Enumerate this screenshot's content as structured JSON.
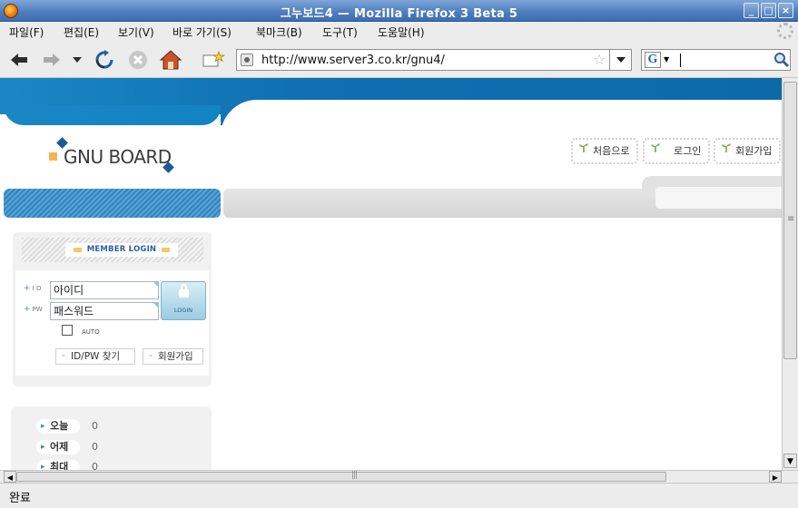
{
  "window": {
    "title": "그누보드4 — Mozilla Firefox 3 Beta 5",
    "min_label": "_",
    "max_label": "□",
    "close_label": "×"
  },
  "menu": [
    {
      "label": "파일(F)"
    },
    {
      "label": "편집(E)"
    },
    {
      "label": "보기(V)"
    },
    {
      "label": "바로 가기(S)"
    },
    {
      "label": "북마크(B)"
    },
    {
      "label": "도구(T)"
    },
    {
      "label": "도움말(H)"
    }
  ],
  "navbar": {
    "url": "http://www.server3.co.kr/gnu4/",
    "search_value": ""
  },
  "site": {
    "logo_text": "GNU BOARD",
    "top_links": [
      {
        "label": "처음으로"
      },
      {
        "label": "로그인"
      },
      {
        "label": "회원가입"
      }
    ]
  },
  "login": {
    "header": "MEMBER LOGIN",
    "id_label": "I D",
    "pw_label": "PW",
    "id_value": "아이디",
    "pw_value": "패스워드",
    "login_button": "LOGIN",
    "auto_label": "AUTO",
    "find_button": "ID/PW 찾기",
    "join_button": "회원가입"
  },
  "stats": [
    {
      "label": "오늘",
      "value": "0"
    },
    {
      "label": "어제",
      "value": "0"
    },
    {
      "label": "최대",
      "value": "0"
    }
  ],
  "status": {
    "text": "완료"
  },
  "colors": {
    "brand_blue": "#1a87c4",
    "titlebar_blue": "#4f7fc0",
    "logo_navy": "#1b5b9b",
    "logo_orange": "#f2b450"
  }
}
